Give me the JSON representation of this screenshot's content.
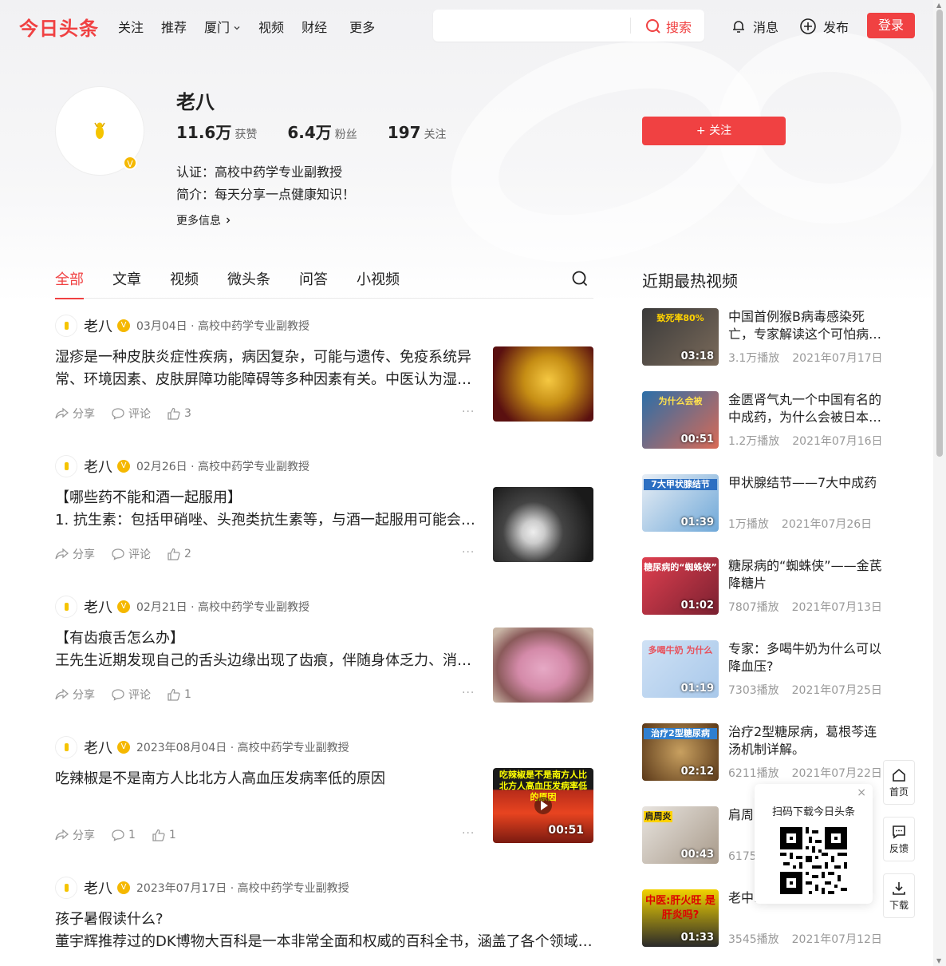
{
  "header": {
    "logo": "今日头条",
    "nav": [
      "关注",
      "推荐",
      "厦门",
      "视频",
      "财经",
      "更多"
    ],
    "search_placeholder": "",
    "search_button": "搜索",
    "messages": "消息",
    "publish": "发布",
    "login": "登录"
  },
  "profile": {
    "name": "老八",
    "likes": "11.6万",
    "likes_label": "获赞",
    "fans": "6.4万",
    "fans_label": "粉丝",
    "following": "197",
    "following_label": "关注",
    "certification": "认证：高校中药学专业副教授",
    "intro": "简介：每天分享一点健康知识！",
    "more_info": "更多信息",
    "follow_button": "+ 关注"
  },
  "tabs": [
    "全部",
    "文章",
    "视频",
    "微头条",
    "问答",
    "小视频"
  ],
  "feed": [
    {
      "author": "老八",
      "meta": "03月04日 · 高校中药学专业副教授",
      "line1": "湿疹是一种皮肤炎症性疾病，病因复杂，可能与遗传、免疫系统异",
      "line2": "常、环境因素、皮肤屏障功能障碍等多种因素有关。中医认为湿…",
      "share": "分享",
      "comment": "评论",
      "likes": "3"
    },
    {
      "author": "老八",
      "meta": "02月26日 · 高校中药学专业副教授",
      "line1": "【哪些药不能和酒一起服用】",
      "line2": "1. 抗生素：包括甲硝唑、头孢类抗生素等，与酒一起服用可能会…",
      "share": "分享",
      "comment": "评论",
      "likes": "2"
    },
    {
      "author": "老八",
      "meta": "02月21日 · 高校中药学专业副教授",
      "line1": "【有齿痕舌怎么办】",
      "line2": "王先生近期发现自己的舌头边缘出现了齿痕，伴随身体乏力、消…",
      "share": "分享",
      "comment": "评论",
      "likes": "1"
    },
    {
      "author": "老八",
      "meta": "2023年08月04日 · 高校中药学专业副教授",
      "line1": "吃辣椒是不是南方人比北方人高血压发病率低的原因",
      "share": "分享",
      "comment": "1",
      "likes": "1",
      "thumb_caption": "吃辣椒是不是南方人比北方人高血压发病率低的原因",
      "duration": "00:51"
    },
    {
      "author": "老八",
      "meta": "2023年07月17日 · 高校中药学专业副教授",
      "line1": "孩子暑假读什么?",
      "line2": "董宇辉推荐过的DK博物大百科是一本非常全面和权威的百科全书，涵盖了各个领域…"
    }
  ],
  "right": {
    "title": "近期最热视频",
    "videos": [
      {
        "title": "中国首例猴B病毒感染死亡，专家解读这个可怕病…",
        "plays": "3.1万播放",
        "date": "2021年07月17日",
        "duration": "03:18",
        "caption": "致死率80%"
      },
      {
        "title": "金匮肾气丸一个中国有名的中成药，为什么会被日本…",
        "plays": "1.2万播放",
        "date": "2021年07月16日",
        "duration": "00:51",
        "caption": "为什么会被"
      },
      {
        "title": "甲状腺结节——7大中成药",
        "plays": "1万播放",
        "date": "2021年07月26日",
        "duration": "01:39",
        "caption": "7大甲状腺结节"
      },
      {
        "title": "糖尿病的“蜘蛛侠”——金芪降糖片",
        "plays": "7807播放",
        "date": "2021年07月13日",
        "duration": "01:02",
        "caption": "糖尿病的“蜘蛛侠”"
      },
      {
        "title": "专家：多喝牛奶为什么可以降血压?",
        "plays": "7303播放",
        "date": "2021年07月25日",
        "duration": "01:19",
        "caption": "多喝牛奶 为什么"
      },
      {
        "title": "治疗2型糖尿病，葛根芩连汤机制详解。",
        "plays": "6211播放",
        "date": "2021年07月22日",
        "duration": "02:12",
        "caption": "治疗2型糖尿病"
      },
      {
        "title": "肩周炎…法。",
        "plays": "6175播放",
        "date": "",
        "duration": "00:43",
        "caption": "肩周炎"
      },
      {
        "title": "老中…吗？",
        "plays": "3545播放",
        "date": "2021年07月12日",
        "duration": "01:33",
        "caption": "中医:肝火旺 是肝炎吗?"
      }
    ]
  },
  "qr_popup": {
    "title": "扫码下载今日头条",
    "close": "×"
  },
  "side_tools": [
    {
      "label": "首页"
    },
    {
      "label": "反馈"
    },
    {
      "label": "下载"
    }
  ],
  "colors": {
    "brand_red": "#f04142",
    "verified_gold": "#f5b800"
  }
}
